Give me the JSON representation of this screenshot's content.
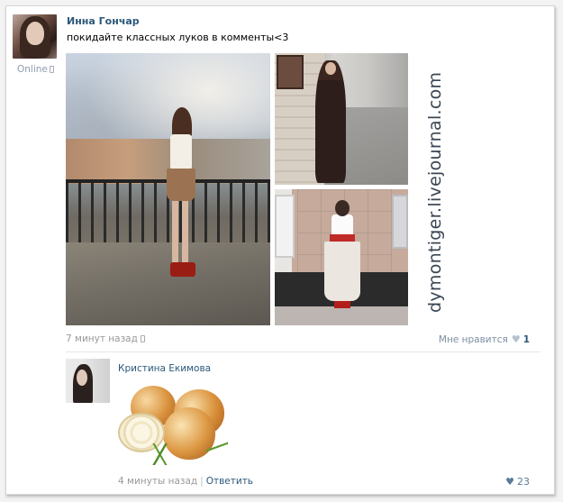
{
  "post": {
    "author": "Инна Гончар",
    "status": "Online",
    "text": "покидайте классных луков в комменты<3",
    "time": "7 минут назад",
    "like_label": "Мне нравится",
    "like_count": "1"
  },
  "watermark": "dymontiger.livejournal.com",
  "comment": {
    "author": "Кристина Екимова",
    "time": "4 минуты назад",
    "reply_label": "Ответить",
    "like_count": "23"
  }
}
